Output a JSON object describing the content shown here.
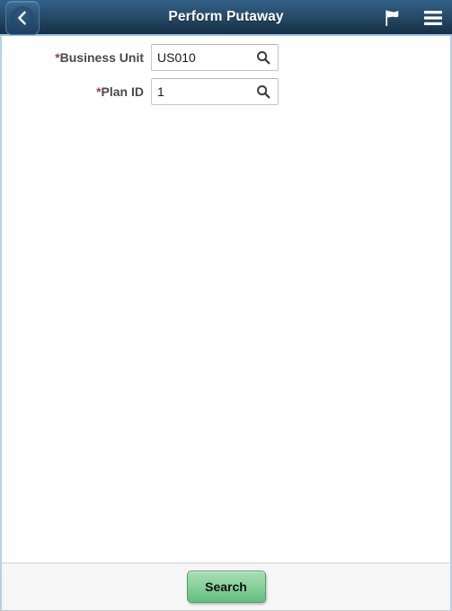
{
  "header": {
    "title": "Perform Putaway",
    "back_icon": "chevron-left-icon",
    "flag_icon": "flag-icon",
    "menu_icon": "hamburger-menu-icon"
  },
  "form": {
    "required_marker": "*",
    "fields": [
      {
        "label": "Business Unit",
        "required": true,
        "value": "US010",
        "placeholder": "",
        "lookup_icon": "search-icon"
      },
      {
        "label": "Plan ID",
        "required": true,
        "value": "1",
        "placeholder": "",
        "lookup_icon": "search-icon"
      }
    ]
  },
  "footer": {
    "search_label": "Search"
  },
  "colors": {
    "header_top": "#33618a",
    "header_bottom": "#153049",
    "header_accent": "#9fc0e2",
    "page_border": "#b9cfe8",
    "required_star": "#8a4a3a",
    "label_text": "#4a4a4a",
    "button_green": "#74c78c",
    "footer_bg": "#f6f6f6"
  }
}
